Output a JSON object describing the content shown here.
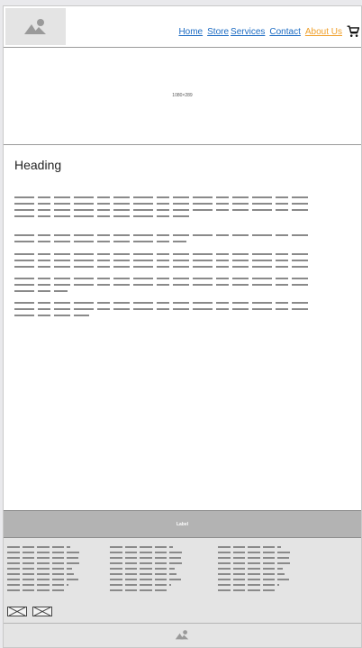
{
  "header": {
    "logo_icon": "image-placeholder-icon",
    "nav": [
      {
        "label": "Home",
        "active": false
      },
      {
        "label": "Store",
        "active": false
      },
      {
        "label": "Services",
        "active": false
      },
      {
        "label": "Contact",
        "active": false
      },
      {
        "label": "About Us",
        "active": true
      }
    ],
    "cart_icon": "shopping-cart-icon"
  },
  "hero": {
    "label": "1080×289"
  },
  "content": {
    "heading": "Heading"
  },
  "footer": {
    "bar_label": "Label",
    "social_icons": [
      "image-placeholder-icon",
      "image-placeholder-icon"
    ],
    "bottom_icon": "image-placeholder-icon"
  },
  "colors": {
    "link": "#1a6ac2",
    "active_link": "#f0a02a",
    "footer_bar": "#b3b3b3",
    "footer_body": "#e4e4e4"
  }
}
